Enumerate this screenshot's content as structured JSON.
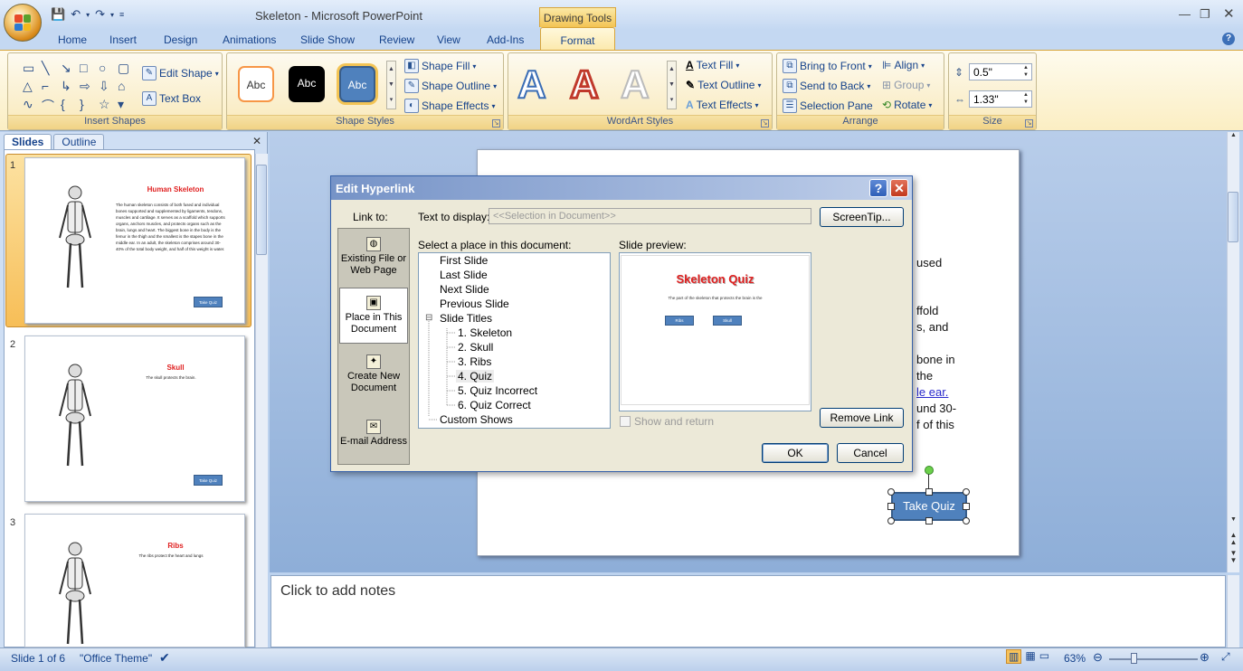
{
  "app": {
    "title": "Skeleton  -  Microsoft PowerPoint",
    "context_tab_group": "Drawing Tools"
  },
  "tabs": [
    "Home",
    "Insert",
    "Design",
    "Animations",
    "Slide Show",
    "Review",
    "View",
    "Add-Ins",
    "Format"
  ],
  "ribbon": {
    "insert_shapes": {
      "label": "Insert Shapes",
      "edit_shape": "Edit Shape",
      "text_box": "Text Box"
    },
    "shape_styles": {
      "label": "Shape Styles",
      "swatch_text": "Abc",
      "shape_fill": "Shape Fill",
      "shape_outline": "Shape Outline",
      "shape_effects": "Shape Effects"
    },
    "wordart_styles": {
      "label": "WordArt Styles",
      "letter": "A",
      "text_fill": "Text Fill",
      "text_outline": "Text Outline",
      "text_effects": "Text Effects"
    },
    "arrange": {
      "label": "Arrange",
      "bring_to_front": "Bring to Front",
      "send_to_back": "Send to Back",
      "selection_pane": "Selection Pane",
      "align": "Align",
      "group": "Group",
      "rotate": "Rotate"
    },
    "size": {
      "label": "Size",
      "height": "0.5\"",
      "width": "1.33\""
    }
  },
  "slides_panel": {
    "tab_slides": "Slides",
    "tab_outline": "Outline",
    "thumbnails": [
      {
        "num": "1",
        "title": "Human Skeleton",
        "body": "The human skeleton consists of both fused and individual bones supported and supplemented by ligaments, tendons, muscles and cartilage. It serves as a scaffold which supports organs, anchors muscles, and protects organs such as the brain, lungs and heart. The biggest bone in the body is the femur in the thigh and the smallest is the stapes bone in the middle ear. In an adult, the skeleton comprises around 30-40% of the total body weight, and half of this weight is water.",
        "button": "Take Quiz"
      },
      {
        "num": "2",
        "title": "Skull",
        "body": "The skull protects the brain.",
        "button": "Take Quiz"
      },
      {
        "num": "3",
        "title": "Ribs",
        "body": "The ribs protect the heart and lungs",
        "button": ""
      }
    ]
  },
  "slide": {
    "text_fragments": [
      "used",
      "ffold",
      "s, and",
      "bone in",
      "the",
      "le ear.",
      "und 30-",
      "f of this"
    ],
    "button": "Take Quiz"
  },
  "notes": {
    "placeholder": "Click to add notes"
  },
  "status": {
    "slide": "Slide 1 of 6",
    "theme": "\"Office Theme\"",
    "zoom": "63%"
  },
  "dialog": {
    "title": "Edit Hyperlink",
    "link_to_label": "Link to:",
    "link_options": [
      "Existing File or Web Page",
      "Place in This Document",
      "Create New Document",
      "E-mail Address"
    ],
    "link_option_keys": [
      "E",
      "A",
      "N",
      "M"
    ],
    "text_to_display_label": "Text to display:",
    "text_to_display_value": "<<Selection in Document>>",
    "screentip": "ScreenTip...",
    "select_place_label": "Select a place in this document:",
    "places": [
      {
        "label": "First Slide",
        "level": 0
      },
      {
        "label": "Last Slide",
        "level": 0
      },
      {
        "label": "Next Slide",
        "level": 0
      },
      {
        "label": "Previous Slide",
        "level": 0
      },
      {
        "label": "Slide Titles",
        "level": 0,
        "expander": "⊟"
      },
      {
        "label": "1. Skeleton",
        "level": 1
      },
      {
        "label": "2. Skull",
        "level": 1
      },
      {
        "label": "3. Ribs",
        "level": 1
      },
      {
        "label": "4. Quiz",
        "level": 1,
        "selected": true
      },
      {
        "label": "5. Quiz Incorrect",
        "level": 1
      },
      {
        "label": "6. Quiz Correct",
        "level": 1
      },
      {
        "label": "Custom Shows",
        "level": 0
      }
    ],
    "slide_preview_label": "Slide preview:",
    "preview": {
      "title": "Skeleton Quiz",
      "subtitle": "The part of the skeleton that protects the brain is the",
      "btn1": "Ribs",
      "btn2": "Skull"
    },
    "show_and_return": "Show and return",
    "remove_link": "Remove Link",
    "ok": "OK",
    "cancel": "Cancel"
  },
  "colors": {
    "accent": "#4f81bd",
    "title_red": "#e02020",
    "ribbon_gold": "#f3c454"
  }
}
